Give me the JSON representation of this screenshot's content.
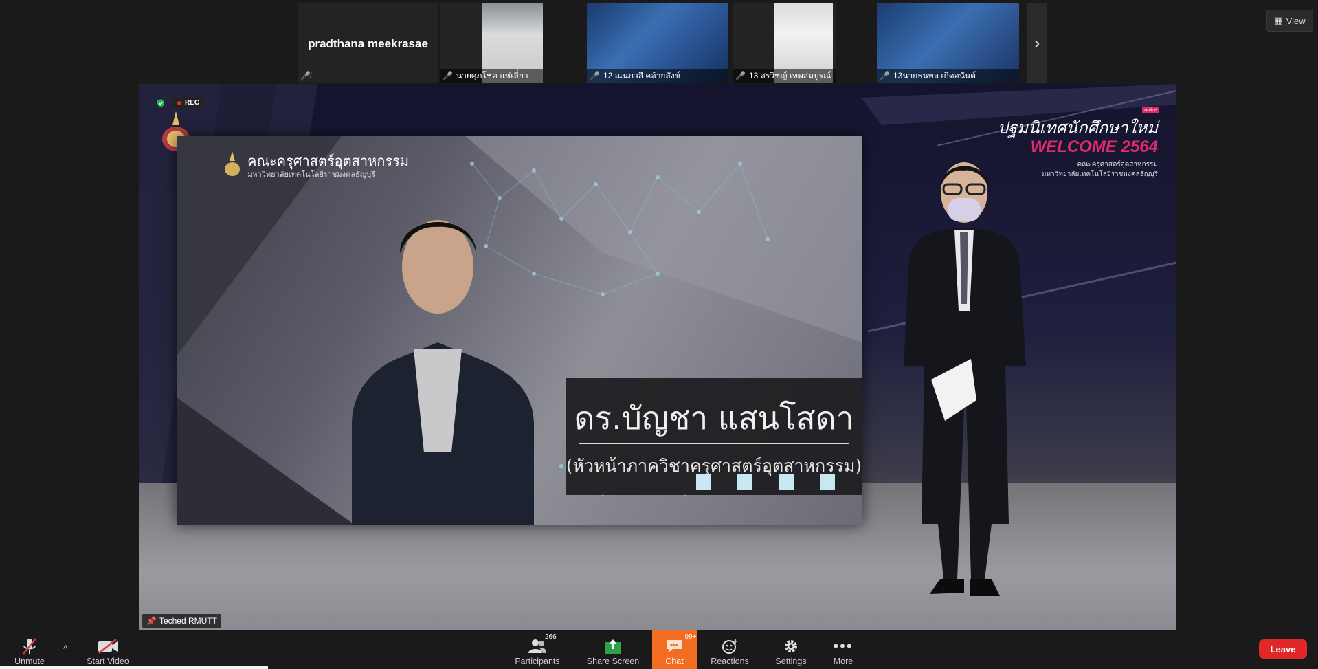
{
  "top_strip": {
    "tiles": [
      {
        "name": "",
        "big_name": "pradthana meekrasae",
        "muted": true
      },
      {
        "name": "นายศุภโชค แซ่เลี่ยว",
        "muted": true
      },
      {
        "name": "12 ณนภวลี คล้ายสังข์",
        "muted": true
      },
      {
        "name": "13 สรวิชญ์ เทพสมบูรณ์",
        "muted": true
      },
      {
        "name": "13นายธนพล เกิดอนันต์",
        "muted": true
      }
    ],
    "next_icon": "›",
    "view_label": "View"
  },
  "main_video": {
    "rec_label": "REC",
    "faculty_line1": "คณะครุศาสตร์อุตสาหกรรม",
    "faculty_line2": "มหาวิทยาลัยเทคโนโลยีราชมงคลธัญบุรี",
    "speaker_name": "ดร.บัญชา แสนโสดา",
    "speaker_title": "(หัวหน้าภาควิชาครุศาสตร์อุตสาหกรรม)",
    "event_title": "ปฐมนิเทศนักศึกษาใหม่",
    "event_subtitle": "WELCOME 2564",
    "event_tag": "online",
    "event_line3": "คณะครุศาสตร์อุตสาหกรรม",
    "event_line4": "มหาวิทยาลัยเทคโนโลยีราชมงคลธัญบุรี",
    "active_speaker_label": "Teched RMUTT"
  },
  "toolbar": {
    "unmute": "Unmute",
    "start_video": "Start Video",
    "participants": "Participants",
    "participants_count": "266",
    "share_screen": "Share Screen",
    "chat": "Chat",
    "chat_badge": "99+",
    "reactions": "Reactions",
    "settings": "Settings",
    "more": "More",
    "leave": "Leave"
  },
  "colors": {
    "accent_orange": "#f26d21",
    "leave_red": "#e02828",
    "share_green": "#2ea24a",
    "muted_red": "#e0373b"
  }
}
